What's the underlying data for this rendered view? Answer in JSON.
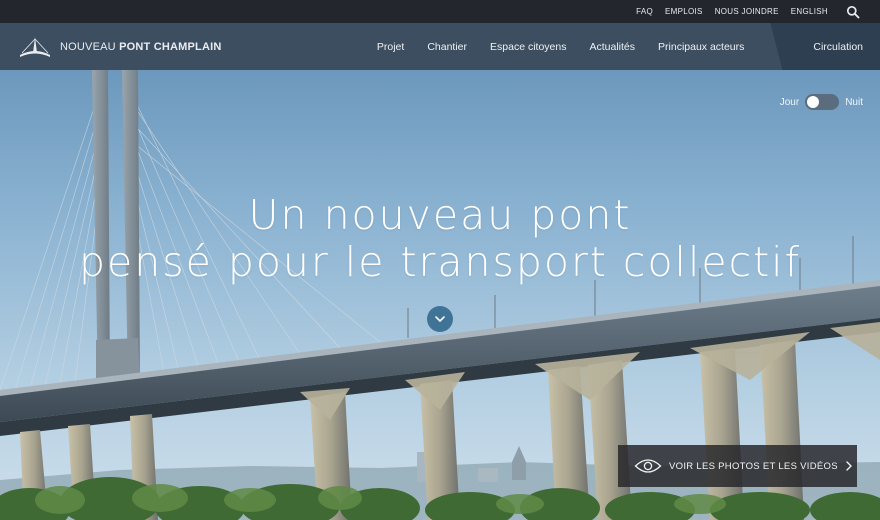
{
  "utility_nav": {
    "items": [
      {
        "label": "FAQ"
      },
      {
        "label": "EMPLOIS"
      },
      {
        "label": "NOUS JOINDRE"
      },
      {
        "label": "ENGLISH"
      }
    ],
    "search_icon": "search-icon"
  },
  "brand": {
    "logo_bold": "NOUVEAU",
    "logo_rest": "PONT CHAMPLAIN"
  },
  "main_nav": {
    "items": [
      {
        "label": "Projet"
      },
      {
        "label": "Chantier"
      },
      {
        "label": "Espace citoyens"
      },
      {
        "label": "Actualités"
      },
      {
        "label": "Principaux acteurs"
      }
    ],
    "circulation": "Circulation"
  },
  "theme_toggle": {
    "left_label": "Jour",
    "right_label": "Nuit",
    "state": "Jour"
  },
  "hero": {
    "headline_line1": "Un nouveau pont",
    "headline_line2": "pensé pour le transport collectif",
    "scroll_icon": "chevron-down-icon",
    "media_button": "VOIR LES PHOTOS ET LES VIDÉOS",
    "media_icon": "eye-icon"
  },
  "colors": {
    "utility_bar": "#23272d",
    "nav_bar": "#364656",
    "circulation_bg": "#2e3f52",
    "scroll_button": "#3f7496",
    "media_button_bg": "#28282c"
  }
}
